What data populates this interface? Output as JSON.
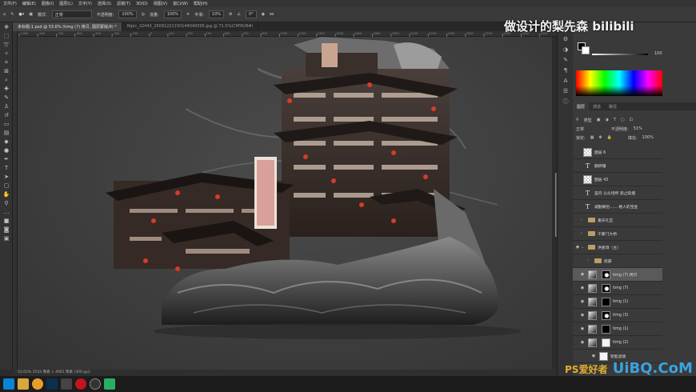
{
  "menu": [
    "文件(F)",
    "编辑(E)",
    "图像(I)",
    "图层(L)",
    "文字(Y)",
    "选择(S)",
    "滤镜(T)",
    "3D(D)",
    "视图(V)",
    "窗口(W)",
    "帮助(H)"
  ],
  "options": {
    "mode_label": "模式:",
    "mode_value": "正常",
    "opacity_label": "不透明度:",
    "opacity_value": "100%",
    "flow_label": "流量:",
    "flow_value": "100%",
    "smooth_label": "平滑:",
    "smooth_value": "10%",
    "angle_value": "0°"
  },
  "tabs": [
    {
      "label": "未标题-1.psd @ 53.6% (timg (7) 拷贝, 图层蒙版/8) *"
    },
    {
      "label": "Nipic_22443_20091221150144049395.jpg @ 71.5%(CMYK/8#)"
    }
  ],
  "ruler_ticks": [
    "-1050",
    "-900",
    "-750",
    "-600",
    "-450",
    "-300",
    "-150",
    "0",
    "150",
    "300",
    "450",
    "600",
    "750",
    "900",
    "1050",
    "1200",
    "1350",
    "1500",
    "1650",
    "1800",
    "1950",
    "2100",
    "2250",
    "2400",
    "2550",
    "2700",
    "2850",
    "3000",
    "3150"
  ],
  "status": "53.65%    3543 像素 × 4961 像素 (300 ppi)",
  "color": {
    "fg": "#000000",
    "bg": "#ffffff",
    "slider_value": "100"
  },
  "panel": {
    "tabs": [
      "图层",
      "通道",
      "路径"
    ],
    "kind_label": "类型",
    "blend_value": "正常",
    "opacity_label": "不透明度:",
    "opacity_value": "51%",
    "lock_label": "锁定:",
    "fill_label": "填充:",
    "fill_value": "100%"
  },
  "layers": [
    {
      "name": "图层 6",
      "type": "pixel"
    },
    {
      "name": "翻转罐",
      "type": "text"
    },
    {
      "name": "图层 43",
      "type": "pixel"
    },
    {
      "name": "室内 公众场所 禁止吸烟",
      "type": "text"
    },
    {
      "name": "诚勤赖怡…… 楼人的宝金",
      "type": "text"
    },
    {
      "name": "重庆礼堂",
      "type": "group"
    },
    {
      "name": "千厮门大桥",
      "type": "group"
    },
    {
      "name": "洪崖洞（主）",
      "type": "group"
    },
    {
      "name": "底部",
      "type": "group"
    },
    {
      "name": "timg (7) 拷贝",
      "type": "masked"
    },
    {
      "name": "timg (7)",
      "type": "masked"
    },
    {
      "name": "timg (1)",
      "type": "masked"
    },
    {
      "name": "timg (3)",
      "type": "masked"
    },
    {
      "name": "timg (1)",
      "type": "masked"
    },
    {
      "name": "timg (2)",
      "type": "masked"
    },
    {
      "name": "智能滤镜",
      "type": "filter"
    }
  ],
  "watermark": "做设计的梨先森  bilibili",
  "watermark_bottom": "UiBQ.CoM",
  "watermark_bottom_small": "PS爱好者"
}
